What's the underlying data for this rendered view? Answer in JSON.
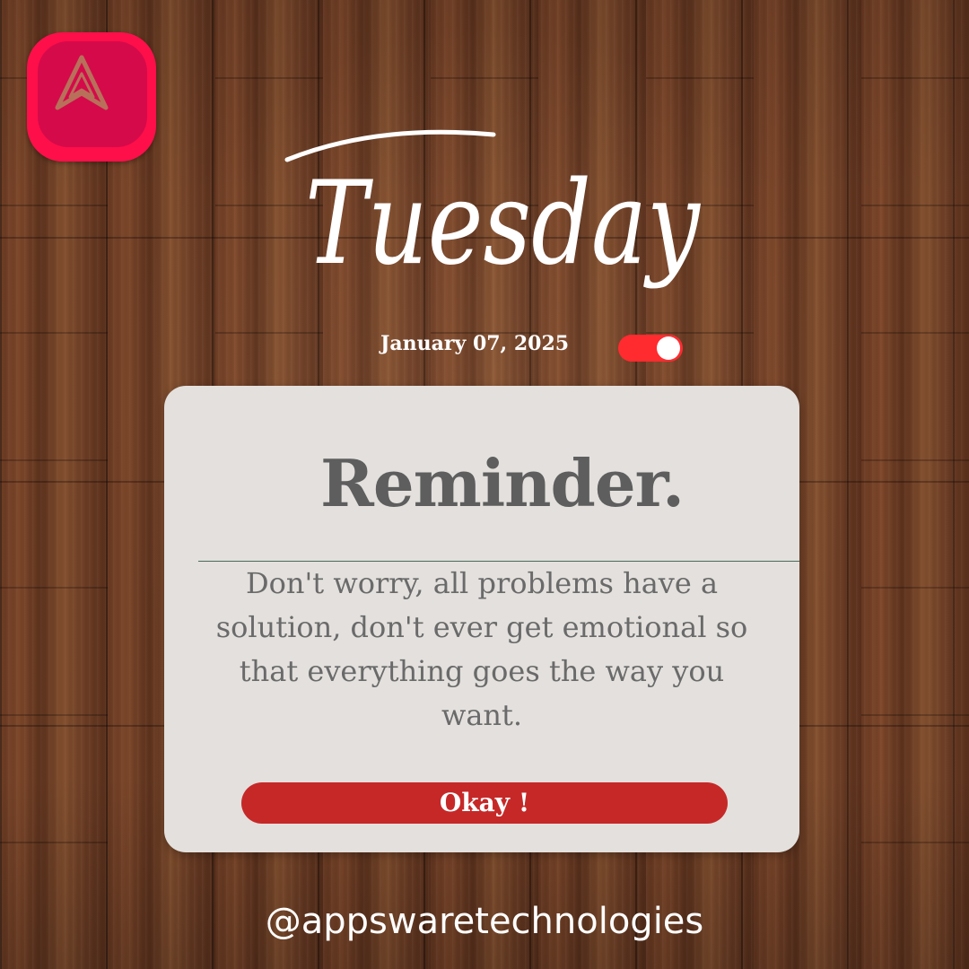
{
  "logo": {
    "icon": "arrow-up-navigation-icon",
    "colors": {
      "outer": "#ff0f4a",
      "inner": "#d50a4a",
      "glyph": "#b8705a"
    }
  },
  "day": "Tuesday",
  "date": "January 07, 2025",
  "toggle": {
    "state": "on",
    "color": "#ff2b2f"
  },
  "reminder": {
    "title": "Reminder.",
    "message": "Don't worry, all problems have a solution, don't ever get emotional so that everything goes the way you want.",
    "button_label": "Okay !",
    "button_color": "#c62828"
  },
  "handle": "@appswaretechnologies"
}
